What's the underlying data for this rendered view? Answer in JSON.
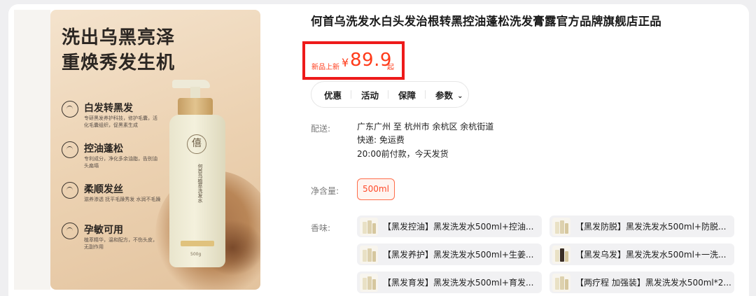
{
  "gallery": {
    "headline_line1": "洗出乌黑亮泽",
    "headline_line2": "重焕秀发生机",
    "features": [
      {
        "title": "白发转黑发",
        "desc": "专研黑发养护科技，修护毛囊，活化毛囊组织，促黑素生成"
      },
      {
        "title": "控油蓬松",
        "desc": "专利成分，净化多余油脂，告别油头扁塌"
      },
      {
        "title": "柔顺发丝",
        "desc": "滋养渗透 抚平毛躁秀发 水润不毛躁"
      },
      {
        "title": "孕敏可用",
        "desc": "植萃精华，温和配方，不伤头皮，无副作用"
      }
    ],
    "bottle_logo": "僖",
    "bottle_text": "何首乌植萃洗发水",
    "bottle_volume": "500g"
  },
  "product": {
    "title": "何首乌洗发水白头发治根转黑控油蓬松洗发膏露官方品牌旗舰店正品",
    "price": {
      "prefix": "新品上新",
      "currency": "¥",
      "amount": "89.9",
      "suffix": "起"
    }
  },
  "tabs": [
    {
      "label": "优惠"
    },
    {
      "label": "活动"
    },
    {
      "label": "保障"
    },
    {
      "label": "参数"
    }
  ],
  "tabs_chevron": "⌄",
  "delivery": {
    "label": "配送:",
    "route": "广东广州 至 杭州市 余杭区 余杭街道",
    "shipping": "快递: 免运费",
    "promise": "20:00前付款，今天发货"
  },
  "volume": {
    "label": "净含量:",
    "selected": "500ml"
  },
  "scent": {
    "label": "香味:",
    "options": [
      "【黑发控油】黑发洗发水500ml+控油...",
      "【黑发防脱】黑发洗发水500ml+防脱...",
      "【黑发养护】黑发洗发水500ml+生姜...",
      "【黑发乌发】黑发洗发水500ml+一洗...",
      "【黑发育发】黑发洗发水500ml+育发...",
      "【两疗程 加强装】黑发洗发水500ml*2..."
    ]
  },
  "colors": {
    "price_red": "#ff3b1a",
    "highlight_border": "#ee1a1a",
    "chip_border": "#ff6d4a"
  }
}
